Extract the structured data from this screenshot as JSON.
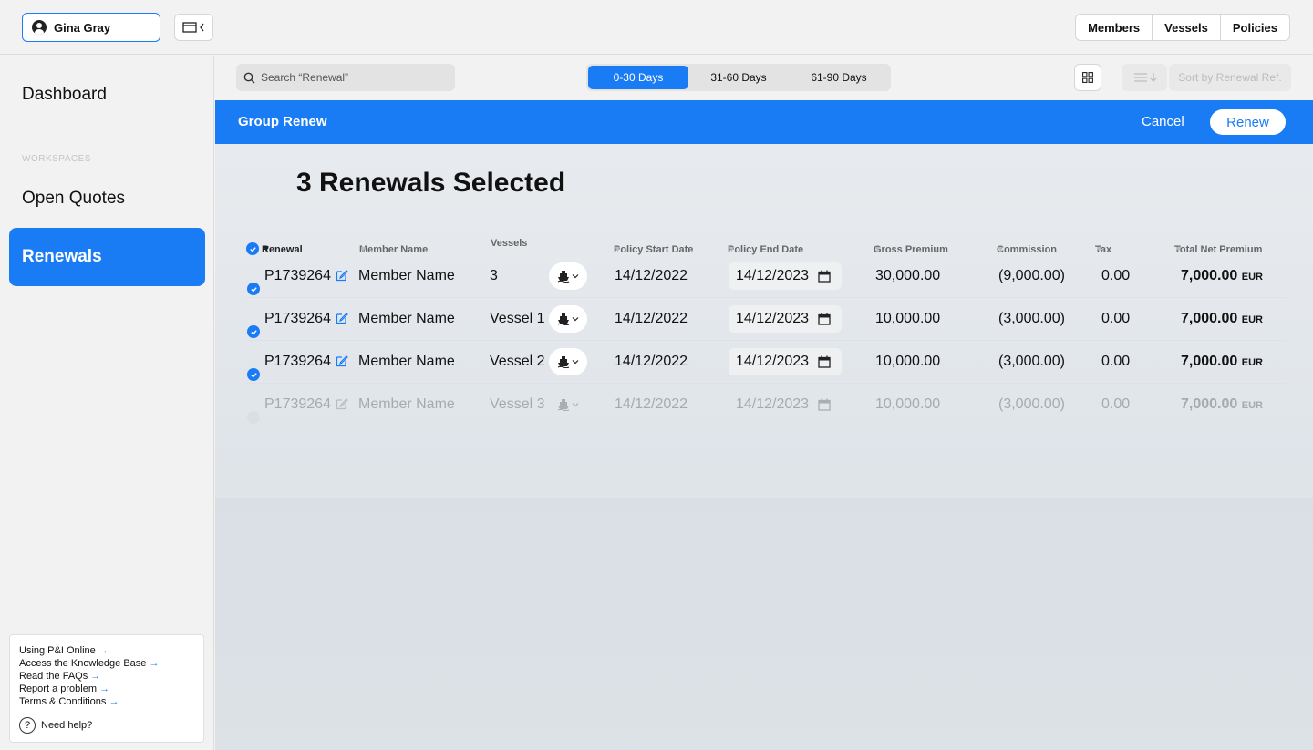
{
  "user": {
    "name": "Gina Gray"
  },
  "top_tabs": [
    "Members",
    "Vessels",
    "Policies"
  ],
  "sidebar": {
    "dashboard": "Dashboard",
    "section_label": "WORKSPACES",
    "open_quotes": "Open Quotes",
    "renewals": "Renewals",
    "help_links": [
      "Using P&I Online",
      "Access the Knowledge Base",
      "Read the FAQs",
      "Report a problem",
      "Terms & Conditions"
    ],
    "need_help": "Need help?"
  },
  "toolbar": {
    "search_placeholder": "Search “Renewal”",
    "ranges": [
      "0-30 Days",
      "31-60 Days",
      "61-90 Days"
    ],
    "active_range": "0-30 Days",
    "sort_label": "Sort by Renewal Ref."
  },
  "group_bar": {
    "title": "Group Renew",
    "cancel": "Cancel",
    "renew": "Renew"
  },
  "selected_title": "3 Renewals Selected",
  "table": {
    "headers": [
      "Renewal",
      "Member Name",
      "Vessels",
      "Policy Start Date",
      "Policy End Date",
      "Gross Premium",
      "Commission",
      "Tax",
      "Total Net Premium"
    ],
    "rows": [
      {
        "ref": "P1739264",
        "member": "Member Name",
        "vessels": "3",
        "start": "14/12/2022",
        "end": "14/12/2023",
        "gross": "30,000.00",
        "commission": "(9,000.00)",
        "tax": "0.00",
        "net": "7,000.00",
        "currency": "EUR",
        "selected": true
      },
      {
        "ref": "P1739264",
        "member": "Member Name",
        "vessels": "Vessel 1",
        "start": "14/12/2022",
        "end": "14/12/2023",
        "gross": "10,000.00",
        "commission": "(3,000.00)",
        "tax": "0.00",
        "net": "7,000.00",
        "currency": "EUR",
        "selected": true
      },
      {
        "ref": "P1739264",
        "member": "Member Name",
        "vessels": "Vessel 2",
        "start": "14/12/2022",
        "end": "14/12/2023",
        "gross": "10,000.00",
        "commission": "(3,000.00)",
        "tax": "0.00",
        "net": "7,000.00",
        "currency": "EUR",
        "selected": true
      },
      {
        "ref": "P1739264",
        "member": "Member Name",
        "vessels": "Vessel 3",
        "start": "14/12/2022",
        "end": "14/12/2023",
        "gross": "10,000.00",
        "commission": "(3,000.00)",
        "tax": "0.00",
        "net": "7,000.00",
        "currency": "EUR",
        "selected": false
      }
    ]
  },
  "colors": {
    "accent": "#1a7cf5"
  }
}
